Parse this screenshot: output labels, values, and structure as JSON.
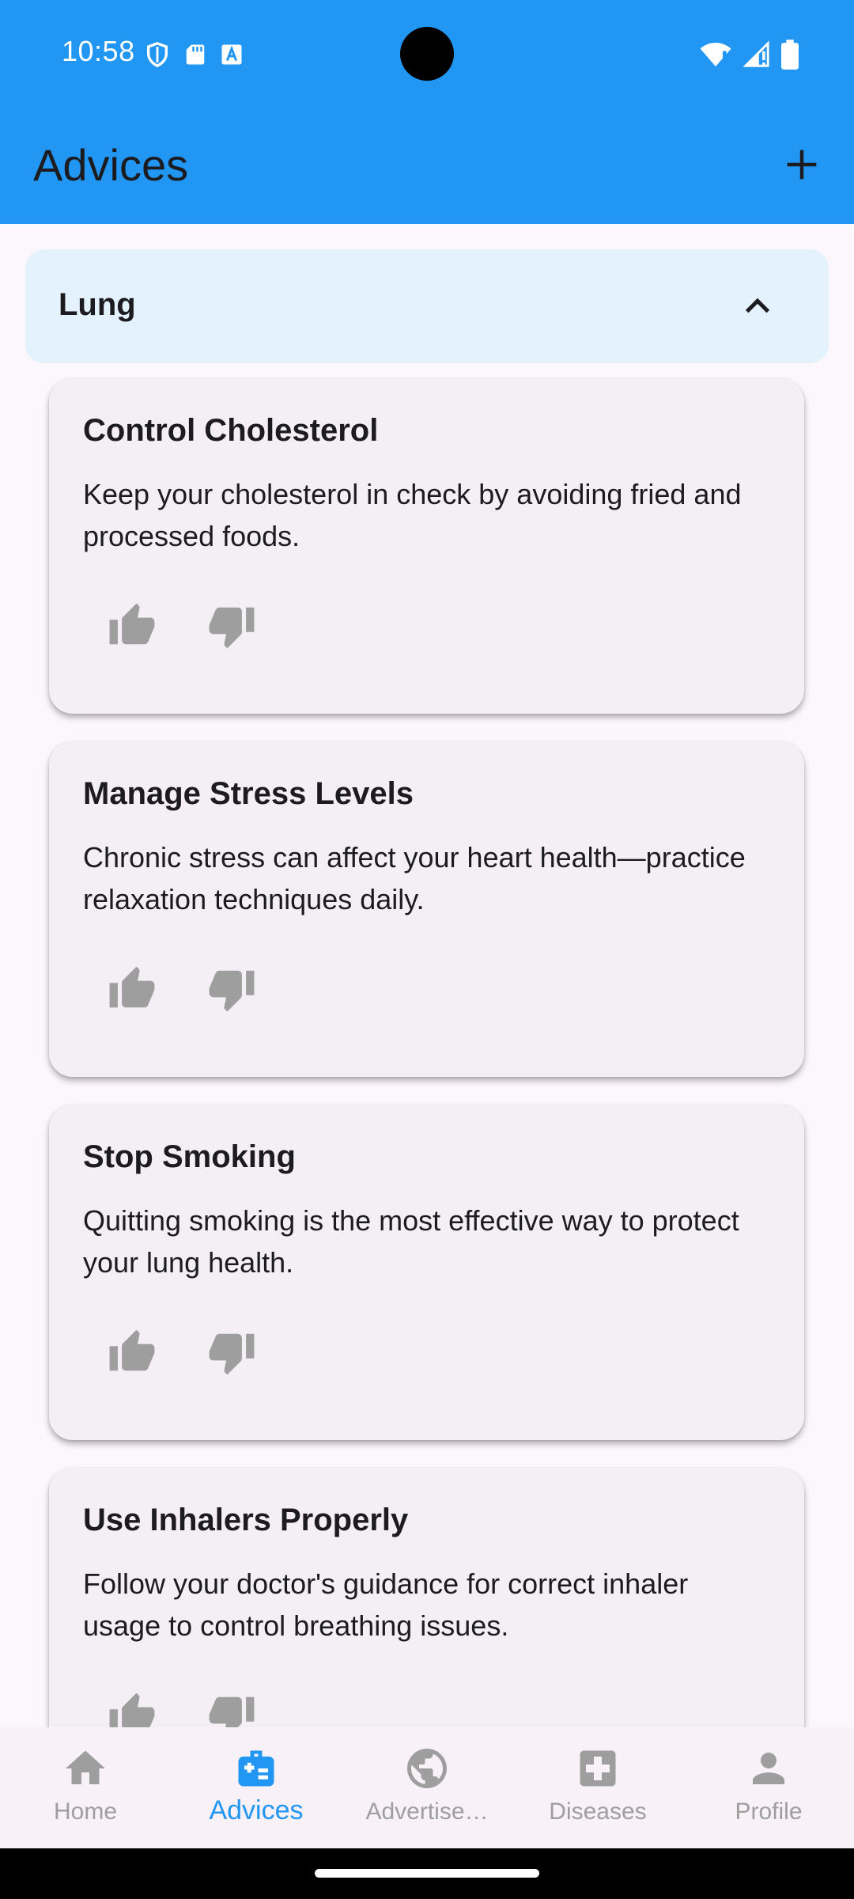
{
  "status_bar": {
    "time": "10:58",
    "left_icons": [
      "shield-icon",
      "sd-card-icon",
      "text-a-icon"
    ],
    "right_icons": [
      "wifi-alert-icon",
      "signal-alert-icon",
      "battery-icon"
    ]
  },
  "app_bar": {
    "title": "Advices",
    "action_icon": "add-icon",
    "background": "#2196f3"
  },
  "category": {
    "label": "Lung",
    "expanded": true,
    "icon": "chevron-up-icon",
    "background": "#e3f2fd"
  },
  "advices": [
    {
      "title": "Control Cholesterol",
      "description": "Keep your cholesterol in check by avoiding fried and processed foods."
    },
    {
      "title": "Manage Stress Levels",
      "description": "Chronic stress can affect your heart health—practice relaxation techniques daily."
    },
    {
      "title": "Stop Smoking",
      "description": "Quitting smoking is the most effective way to protect your lung health."
    },
    {
      "title": "Use Inhalers Properly",
      "description": "Follow your doctor's guidance for correct inhaler usage to control breathing issues."
    }
  ],
  "bottom_nav": {
    "items": [
      {
        "label": "Home",
        "icon": "home-icon",
        "active": false
      },
      {
        "label": "Advices",
        "icon": "medical-kit-icon",
        "active": true
      },
      {
        "label": "Advertise…",
        "icon": "globe-icon",
        "active": false
      },
      {
        "label": "Diseases",
        "icon": "medical-cross-icon",
        "active": false
      },
      {
        "label": "Profile",
        "icon": "person-icon",
        "active": false
      }
    ],
    "active_color": "#2196f3",
    "inactive_color": "#9e9e9e"
  }
}
